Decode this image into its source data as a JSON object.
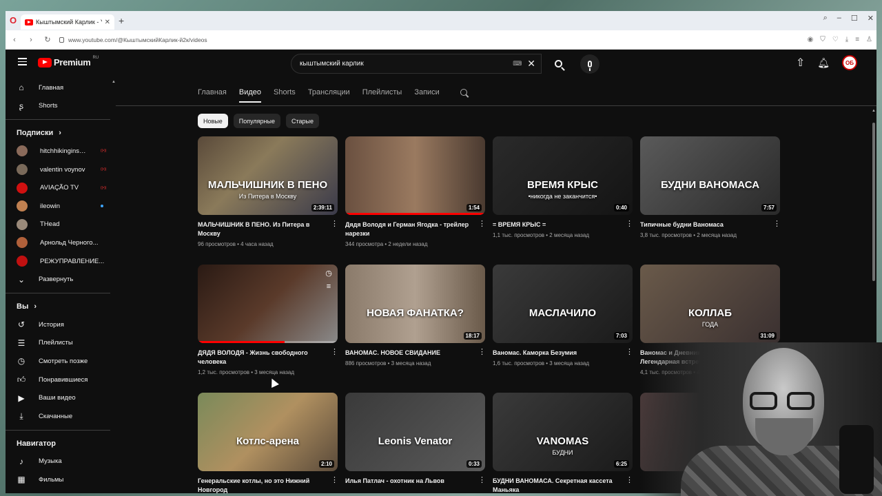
{
  "browser": {
    "tab_title": "Кыштымский Карлик - Y",
    "url": "www.youtube.com/@КыштымскийКарлик-й2к/videos"
  },
  "masthead": {
    "logo_text": "Premium",
    "logo_region": "RU",
    "search_value": "кыштымский карлик",
    "avatar_initials": "ОБ"
  },
  "sidebar": {
    "main_items": [
      {
        "label": "Главная",
        "icon": "home-icon"
      },
      {
        "label": "Shorts",
        "icon": "shorts-icon"
      }
    ],
    "subscriptions_heading": "Подписки",
    "subscriptions": [
      {
        "label": "hitchhikinginsaig...",
        "color": "#8a6a5a",
        "live": true
      },
      {
        "label": "valentin voynov",
        "color": "#7a6a5a",
        "live": true
      },
      {
        "label": "AVIAÇÃO TV",
        "color": "#d01010",
        "live": true
      },
      {
        "label": "ileowin",
        "color": "#c08050",
        "live": false,
        "new": true
      },
      {
        "label": "THead",
        "color": "#9a8a7a",
        "live": false
      },
      {
        "label": "Арнольд Черного...",
        "color": "#b0603a",
        "live": false
      },
      {
        "label": "РЕЖУПРАВЛЕНИЕ...",
        "color": "#c01010",
        "live": false
      }
    ],
    "expand_label": "Развернуть",
    "you_heading": "Вы",
    "you_items": [
      {
        "label": "История",
        "icon": "history-icon"
      },
      {
        "label": "Плейлисты",
        "icon": "playlists-icon"
      },
      {
        "label": "Смотреть позже",
        "icon": "watch-later-icon"
      },
      {
        "label": "Понравившиеся",
        "icon": "like-icon"
      },
      {
        "label": "Ваши видео",
        "icon": "your-videos-icon"
      },
      {
        "label": "Скачанные",
        "icon": "download-icon"
      }
    ],
    "navigator_heading": "Навигатор",
    "navigator_items": [
      {
        "label": "Музыка",
        "icon": "music-icon"
      },
      {
        "label": "Фильмы",
        "icon": "movies-icon"
      }
    ]
  },
  "channel_tabs": [
    "Главная",
    "Видео",
    "Shorts",
    "Трансляции",
    "Плейлисты",
    "Записи"
  ],
  "active_tab": "Видео",
  "chips": [
    "Новые",
    "Популярные",
    "Старые"
  ],
  "videos": [
    {
      "title": "МАЛЬЧИШНИК В ПЕНО. Из Питера в Москву",
      "stats": "96 просмотров • 4 часа назад",
      "duration": "2:39:11",
      "thumb_text": "МАЛЬЧИШНИК В ПЕНО",
      "thumb_sub": "Из Питера в Москву",
      "bg": "linear-gradient(135deg,#5a4a3a,#8a7a5a 40%,#3a3a4a)"
    },
    {
      "title": "Дядя Володя и Герман Ягодка - трейлер нарезки",
      "stats": "344 просмотра • 2 недели назад",
      "duration": "1:54",
      "thumb_text": "",
      "thumb_sub": "",
      "bg": "linear-gradient(90deg,#6a5040,#9a7a60 50%,#4a3a30)",
      "progress": 1.0
    },
    {
      "title": "= ВРЕМЯ КРЫС =",
      "stats": "1,1 тыс. просмотров • 2 месяца назад",
      "duration": "0:40",
      "thumb_text": "ВРЕМЯ КРЫС",
      "thumb_sub": "•никогда не заканчится•",
      "bg": "linear-gradient(135deg,#2a2a2a,#141414)"
    },
    {
      "title": "Типичные будни Ваномаса",
      "stats": "3,8 тыс. просмотров • 2 месяца назад",
      "duration": "7:57",
      "thumb_text": "БУДНИ ВАНОМАСА",
      "thumb_sub": "",
      "bg": "linear-gradient(135deg,#5a5a5a,#2a2a2a)"
    },
    {
      "title": "ДЯДЯ ВОЛОДЯ - Жизнь свободного человека",
      "stats": "1,2 тыс. просмотров • 3 месяца назад",
      "duration": "",
      "thumb_text": "",
      "thumb_sub": "",
      "bg": "linear-gradient(135deg,#2a1a14,#5a3a2a 50%,#8a8a8a)",
      "progress": 0.62,
      "hover": true
    },
    {
      "title": "ВАНОМАС. НОВОЕ СВИДАНИЕ",
      "stats": "886 просмотров • 3 месяца назад",
      "duration": "18:17",
      "thumb_text": "НОВАЯ ФАНАТКА?",
      "thumb_sub": "",
      "bg": "linear-gradient(90deg,#8a7a6a,#b0a090 50%,#6a5a4a)"
    },
    {
      "title": "Ваномас. Каморка Безумия",
      "stats": "1,6 тыс. просмотров • 3 месяца назад",
      "duration": "7:03",
      "thumb_text": "МАСЛАЧИЛО",
      "thumb_sub": "",
      "bg": "linear-gradient(135deg,#3a3a3a,#1a1a1a)"
    },
    {
      "title": "Ваномас и Дневник девственника. Легендарная встреча двух разумов",
      "stats": "4,1 тыс. просмотров • 4 месяца назад",
      "duration": "31:09",
      "thumb_text": "КОЛЛАБ",
      "thumb_sub": "ГОДА",
      "bg": "linear-gradient(135deg,#6a5a4a,#3a3030)"
    },
    {
      "title": "Генеральские котлы, но это Нижний Новгород",
      "stats": "",
      "duration": "2:10",
      "thumb_text": "Котлс-арена",
      "thumb_sub": "",
      "bg": "linear-gradient(135deg,#7a8a5a,#b09060 50%,#5a4a3a)"
    },
    {
      "title": "Илья Патлач - охотник на Львов",
      "stats": "",
      "duration": "0:33",
      "thumb_text": "Leonis Venator",
      "thumb_sub": "",
      "bg": "linear-gradient(135deg,#3a3a3a,#5a5a5a)"
    },
    {
      "title": "БУДНИ ВАНОМАСА. Секретная кассета Маньяка",
      "stats": "",
      "duration": "6:25",
      "thumb_text": "VANOMAS",
      "thumb_sub": "БУДНИ",
      "bg": "linear-gradient(135deg,#3a3a3a,#1a1a1a)"
    },
    {
      "title": "",
      "stats": "",
      "duration": "",
      "thumb_text": "",
      "thumb_sub": "",
      "bg": "linear-gradient(135deg,#4a3a3a,#2a2a2a)"
    }
  ]
}
